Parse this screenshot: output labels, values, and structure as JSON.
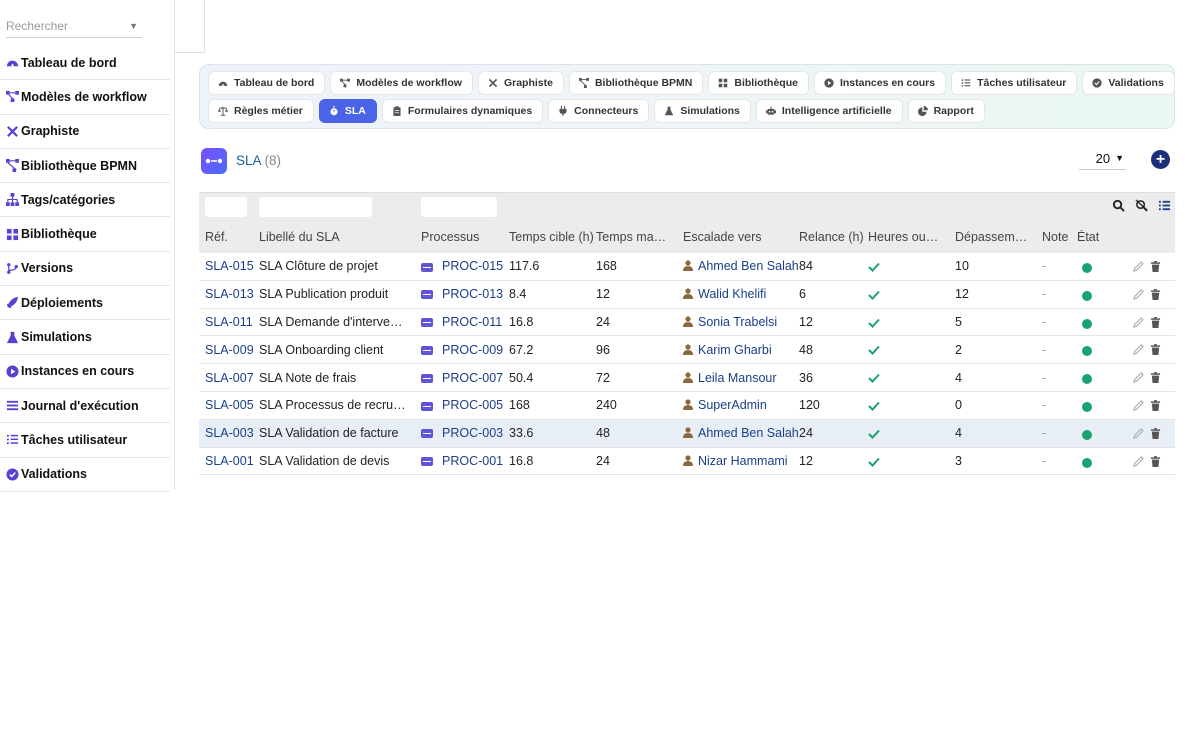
{
  "search": {
    "placeholder": "Rechercher"
  },
  "sidebar": {
    "items": [
      {
        "label": "Tableau de bord",
        "icon": "dashboard-icon"
      },
      {
        "label": "Modèles de workflow",
        "icon": "workflow-icon"
      },
      {
        "label": "Graphiste",
        "icon": "tools-icon"
      },
      {
        "label": "Bibliothèque BPMN",
        "icon": "bpmn-icon"
      },
      {
        "label": "Tags/catégories",
        "icon": "sitemap-icon"
      },
      {
        "label": "Bibliothèque",
        "icon": "grid-icon"
      },
      {
        "label": "Versions",
        "icon": "branch-icon"
      },
      {
        "label": "Déploiements",
        "icon": "rocket-icon"
      },
      {
        "label": "Simulations",
        "icon": "flask-icon"
      },
      {
        "label": "Instances en cours",
        "icon": "play-circle-icon"
      },
      {
        "label": "Journal d'exécution",
        "icon": "list-icon"
      },
      {
        "label": "Tâches utilisateur",
        "icon": "tasks-icon"
      },
      {
        "label": "Validations",
        "icon": "check-circle-icon"
      }
    ]
  },
  "tabs": {
    "row1": [
      {
        "label": "Tableau de bord",
        "icon": "dashboard-icon"
      },
      {
        "label": "Modèles de workflow",
        "icon": "workflow-icon"
      },
      {
        "label": "Graphiste",
        "icon": "tools-icon"
      },
      {
        "label": "Bibliothèque BPMN",
        "icon": "bpmn-icon"
      },
      {
        "label": "Bibliothèque",
        "icon": "grid-icon"
      },
      {
        "label": "Instances en cours",
        "icon": "play-circle-icon"
      },
      {
        "label": "Tâches utilisateur",
        "icon": "tasks-icon"
      },
      {
        "label": "Validations",
        "icon": "check-circle-icon"
      }
    ],
    "row2": [
      {
        "label": "Règles métier",
        "icon": "scale-icon"
      },
      {
        "label": "SLA",
        "icon": "stopwatch-icon",
        "active": true
      },
      {
        "label": "Formulaires dynamiques",
        "icon": "clipboard-icon"
      },
      {
        "label": "Connecteurs",
        "icon": "plug-icon"
      },
      {
        "label": "Simulations",
        "icon": "flask-icon"
      },
      {
        "label": "Intelligence artificielle",
        "icon": "robot-icon"
      },
      {
        "label": "Rapport",
        "icon": "pie-chart-icon"
      }
    ]
  },
  "page": {
    "title": "SLA",
    "count": "(8)",
    "page_size": "20"
  },
  "colors": {
    "accent": "#4a63e7",
    "link": "#1b3f8a",
    "status_ok": "#1aa36f",
    "add_button": "#1e2f7a"
  },
  "table": {
    "headers": {
      "ref": "Réf.",
      "label": "Libellé du SLA",
      "process": "Processus",
      "target": "Temps cible (h)",
      "max": "Temps maxi…",
      "escalation": "Escalade vers",
      "reminder": "Relance (h)",
      "business_hours": "Heures ouvr…",
      "overrun": "Dépasseme…",
      "note": "Note",
      "state": "État"
    },
    "rows": [
      {
        "ref": "SLA-015",
        "label": "SLA Clôture de projet",
        "process": "PROC-015",
        "target": "117.6",
        "max": "168",
        "escalation": "Ahmed Ben Salah",
        "reminder": "84",
        "overrun": "10",
        "note": "-"
      },
      {
        "ref": "SLA-013",
        "label": "SLA Publication produit",
        "process": "PROC-013",
        "target": "8.4",
        "max": "12",
        "escalation": "Walid Khelifi",
        "reminder": "6",
        "overrun": "12",
        "note": "-"
      },
      {
        "ref": "SLA-011",
        "label": "SLA Demande d'intervention",
        "process": "PROC-011",
        "target": "16.8",
        "max": "24",
        "escalation": "Sonia Trabelsi",
        "reminder": "12",
        "overrun": "5",
        "note": "-"
      },
      {
        "ref": "SLA-009",
        "label": "SLA Onboarding client",
        "process": "PROC-009",
        "target": "67.2",
        "max": "96",
        "escalation": "Karim Gharbi",
        "reminder": "48",
        "overrun": "2",
        "note": "-"
      },
      {
        "ref": "SLA-007",
        "label": "SLA Note de frais",
        "process": "PROC-007",
        "target": "50.4",
        "max": "72",
        "escalation": "Leila Mansour",
        "reminder": "36",
        "overrun": "4",
        "note": "-"
      },
      {
        "ref": "SLA-005",
        "label": "SLA Processus de recrutem…",
        "process": "PROC-005",
        "target": "168",
        "max": "240",
        "escalation": "SuperAdmin",
        "reminder": "120",
        "overrun": "0",
        "note": "-"
      },
      {
        "ref": "SLA-003",
        "label": "SLA Validation de facture",
        "process": "PROC-003",
        "target": "33.6",
        "max": "48",
        "escalation": "Ahmed Ben Salah",
        "reminder": "24",
        "overrun": "4",
        "note": "-",
        "highlighted": true
      },
      {
        "ref": "SLA-001",
        "label": "SLA Validation de devis",
        "process": "PROC-001",
        "target": "16.8",
        "max": "24",
        "escalation": "Nizar Hammami",
        "reminder": "12",
        "overrun": "3",
        "note": "-"
      }
    ]
  }
}
